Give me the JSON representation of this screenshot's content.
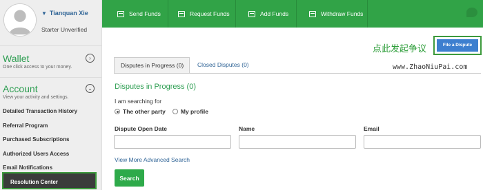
{
  "sidebar": {
    "user_name": "Tianquan Xie",
    "user_status": "Starter Unverified",
    "wallet": {
      "title": "Wallet",
      "subtitle": "One click access to your money."
    },
    "account": {
      "title": "Account",
      "subtitle": "View your activity and settings."
    },
    "items": [
      {
        "label": "Detailed Transaction History"
      },
      {
        "label": "Referral Program"
      },
      {
        "label": "Purchased Subscriptions"
      },
      {
        "label": "Authorized Users Access"
      },
      {
        "label": "Email Notifications"
      },
      {
        "label": "Resolution Center"
      }
    ]
  },
  "topbar": {
    "buttons": [
      {
        "label": "Send Funds"
      },
      {
        "label": "Request Funds"
      },
      {
        "label": "Add Funds"
      },
      {
        "label": "Withdraw Funds"
      }
    ]
  },
  "annotation": "点此发起争议",
  "file_dispute_label": "File a Dispute",
  "watermark": "www.ZhaoNiuPai.com",
  "tabs": [
    {
      "label": "Disputes in Progress (0)"
    },
    {
      "label": "Closed Disputes (0)"
    }
  ],
  "main": {
    "heading": "Disputes in Progress (0)",
    "searching_label": "I am searching for",
    "radio_other": "The other party",
    "radio_profile": "My profile",
    "field_date": "Dispute Open Date",
    "field_name": "Name",
    "field_email": "Email",
    "advanced_link": "View More Advanced Search",
    "search_button": "Search"
  },
  "colors": {
    "brand_green": "#31a347",
    "link_blue": "#2f6496",
    "button_blue": "#3d7fcf",
    "highlight_border": "#3c9a3c"
  }
}
